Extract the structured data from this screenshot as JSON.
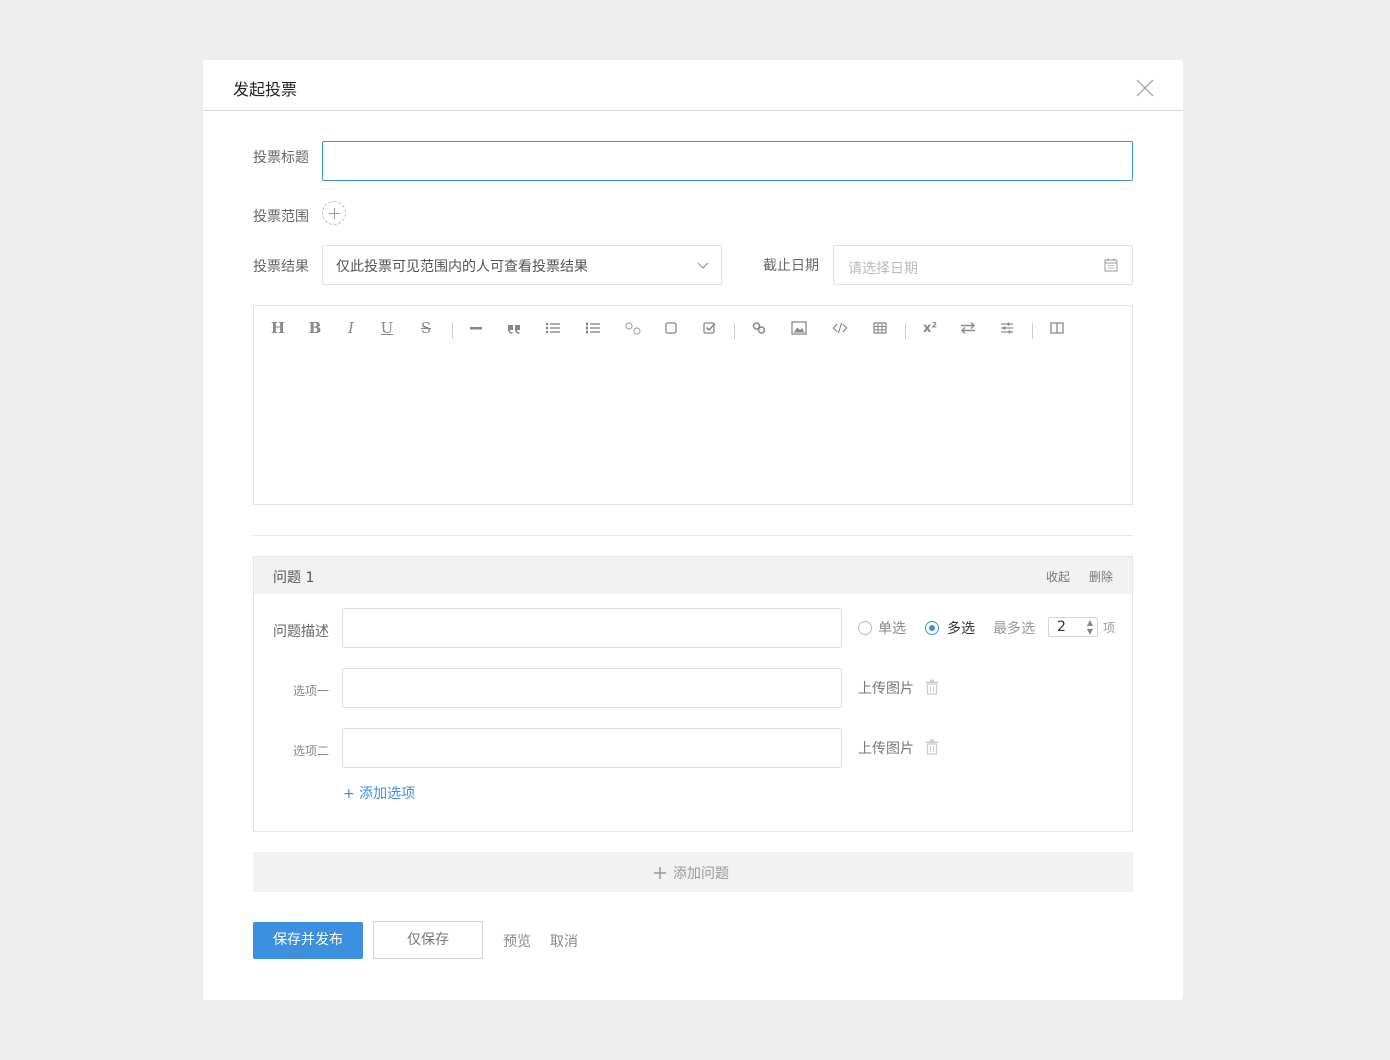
{
  "dialog": {
    "title": "发起投票",
    "close_icon": "close-icon"
  },
  "form": {
    "title_label": "投票标题",
    "title_value": "",
    "scope_label": "投票范围",
    "result_label": "投票结果",
    "result_value": "仅此投票可见范围内的人可查看投票结果",
    "deadline_label": "截止日期",
    "deadline_placeholder": "请选择日期"
  },
  "toolbar": {
    "icons": [
      "heading-icon",
      "bold-icon",
      "italic-icon",
      "underline-icon",
      "strikethrough-icon",
      "horizontal-rule-icon",
      "quote-icon",
      "bullet-list-icon",
      "ordered-list-icon",
      "unlink-icon",
      "checkbox-icon",
      "checkbox-checked-icon",
      "link-icon",
      "image-icon",
      "code-icon",
      "table-icon",
      "superscript-icon",
      "swap-icon",
      "sliders-icon",
      "columns-icon"
    ],
    "heading": "H",
    "bold": "B",
    "italic": "I",
    "underline": "U",
    "strike": "S",
    "superscript": "x²"
  },
  "question": {
    "title": "问题 1",
    "collapse": "收起",
    "delete": "删除",
    "desc_label": "问题描述",
    "desc_value": "",
    "single": "单选",
    "multiple": "多选",
    "selected_type": "多选",
    "max_label": "最多选",
    "max_value": "2",
    "max_unit": "项",
    "options": [
      {
        "label": "选项一",
        "value": "",
        "upload": "上传图片"
      },
      {
        "label": "选项二",
        "value": "",
        "upload": "上传图片"
      }
    ],
    "add_option": "+ 添加选项"
  },
  "add_question": "添加问题",
  "actions": {
    "save_publish": "保存并发布",
    "save_only": "仅保存",
    "preview": "预览",
    "cancel": "取消"
  },
  "colors": {
    "accent": "#3d8fe0",
    "background": "#eeeeee"
  }
}
